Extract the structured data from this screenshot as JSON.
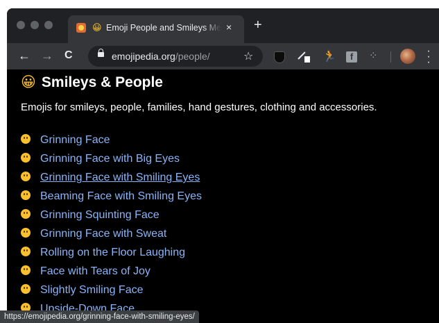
{
  "tab": {
    "emoji": "😀",
    "title": "Emoji People and Smileys Meanings",
    "close": "×"
  },
  "newtab_label": "+",
  "nav": {
    "back": "←",
    "forward": "→",
    "reload": "C"
  },
  "address": {
    "host": "emojipedia.org",
    "path": "/people/"
  },
  "page": {
    "heading_emoji": "😀",
    "heading": "Smileys & People",
    "description": "Emojis for smileys, people, families, hand gestures, clothing and accessories."
  },
  "items": [
    {
      "emoji": "😀",
      "label": "Grinning Face"
    },
    {
      "emoji": "😃",
      "label": "Grinning Face with Big Eyes"
    },
    {
      "emoji": "😄",
      "label": "Grinning Face with Smiling Eyes"
    },
    {
      "emoji": "😁",
      "label": "Beaming Face with Smiling Eyes"
    },
    {
      "emoji": "😆",
      "label": "Grinning Squinting Face"
    },
    {
      "emoji": "😅",
      "label": "Grinning Face with Sweat"
    },
    {
      "emoji": "🤣",
      "label": "Rolling on the Floor Laughing"
    },
    {
      "emoji": "😂",
      "label": "Face with Tears of Joy"
    },
    {
      "emoji": "🙂",
      "label": "Slightly Smiling Face"
    },
    {
      "emoji": "🙃",
      "label": "Upside-Down Face"
    }
  ],
  "hovered_item": "Grinning Face with Smiling Eyes",
  "status_url": "https://emojipedia.org/grinning-face-with-smiling-eyes/",
  "colors": {
    "link": "#8ab4f8",
    "page_bg": "#000000",
    "toolbar": "#35363a",
    "titlebar": "#202124"
  },
  "icons": {
    "extensions": [
      "shield-icon",
      "pen-icon",
      "runner-icon",
      "facebook-icon",
      "dots-icon"
    ],
    "profile": "avatar",
    "menu": "kebab-menu-icon"
  }
}
